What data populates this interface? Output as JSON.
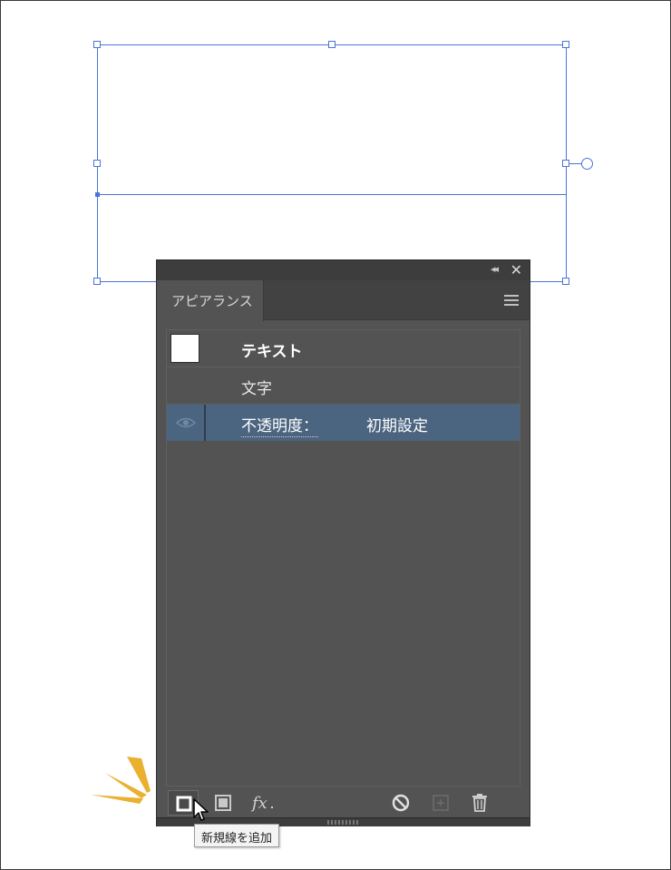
{
  "canvas": {
    "selection_color": "#4a74d9"
  },
  "panel": {
    "tab_label": "アピアランス",
    "collapse_icon": "double-chevron-left-icon",
    "close_icon": "close-icon",
    "menu_icon": "hamburger-menu-icon",
    "background_color": "#535353",
    "selected_row_color": "#4b6480",
    "rows": [
      {
        "label": "テキスト",
        "type": "object-header",
        "thumbnail_color": "#ffffff"
      },
      {
        "label": "文字",
        "type": "characters"
      },
      {
        "label": "不透明度：",
        "value": "初期設定",
        "type": "opacity",
        "visible": true,
        "selected": true
      }
    ],
    "bottom_toolbar": [
      {
        "name": "add-new-stroke",
        "icon": "square-stroke-icon"
      },
      {
        "name": "add-new-fill",
        "icon": "square-fill-icon"
      },
      {
        "name": "add-new-effect",
        "icon": "fx-icon"
      },
      {
        "name": "clear-appearance",
        "icon": "no-icon"
      },
      {
        "name": "duplicate-item",
        "icon": "plus-square-icon"
      },
      {
        "name": "delete-item",
        "icon": "trash-icon"
      }
    ]
  },
  "tooltip": {
    "text": "新規線を追加"
  },
  "highlight_color": "#eab030"
}
